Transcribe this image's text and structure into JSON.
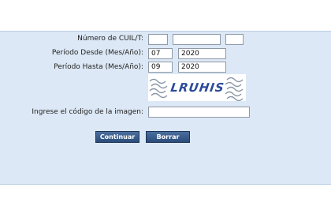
{
  "form": {
    "cuil_label": "Número de CUIL/T:",
    "cuil_part1": "",
    "cuil_part2": "",
    "cuil_part3": "",
    "desde_label": "Período Desde (Mes/Año):",
    "desde_mes": "07",
    "desde_anio": "2020",
    "hasta_label": "Período Hasta (Mes/Año):",
    "hasta_mes": "09",
    "hasta_anio": "2020",
    "captcha_text": "LRUHIS",
    "codigo_label": "Ingrese el código de la imagen:",
    "codigo_value": ""
  },
  "buttons": {
    "continuar": "Continuar",
    "borrar": "Borrar"
  },
  "colors": {
    "panel_bg": "#dce8f5",
    "button_bg": "#2f5381",
    "captcha_text": "#2b4a9a"
  }
}
